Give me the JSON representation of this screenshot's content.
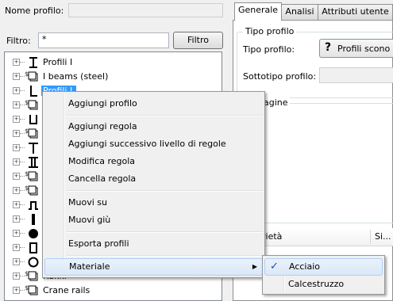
{
  "header": {
    "profile_name_label": "Nome profilo:",
    "profile_name_value": ""
  },
  "filter": {
    "label": "Filtro:",
    "value": "*",
    "button_label": "Filtro"
  },
  "tabs": [
    {
      "label": "Generale",
      "active": true
    },
    {
      "label": "Analisi",
      "active": false
    },
    {
      "label": "Attributi utente",
      "active": false
    }
  ],
  "general": {
    "group_title": "Tipo profilo",
    "type_label": "Tipo profilo:",
    "type_value": "Profili scono",
    "subtype_label": "Sottotipo profilo:",
    "subtype_value": "",
    "image_group_partial": "agine",
    "table_headers": [
      "rietà",
      "Si..."
    ]
  },
  "tree": {
    "items": [
      {
        "label": "Profili I",
        "icon": "i-beam-icon"
      },
      {
        "label": "I beams (steel)",
        "icon": "library-icon"
      },
      {
        "label": "Profili L",
        "icon": "l-profile-icon"
      },
      {
        "label": "",
        "icon": "library-icon"
      },
      {
        "label": "",
        "icon": "u-profile-icon"
      },
      {
        "label": "",
        "icon": "library-icon"
      },
      {
        "label": "",
        "icon": "t-profile-icon"
      },
      {
        "label": "",
        "icon": "double-i-icon"
      },
      {
        "label": "",
        "icon": "library-icon"
      },
      {
        "label": "",
        "icon": "library-icon"
      },
      {
        "label": "",
        "icon": "z-profile-icon"
      },
      {
        "label": "",
        "icon": "flat-bar-icon"
      },
      {
        "label": "",
        "icon": "round-bar-icon"
      },
      {
        "label": "",
        "icon": "rect-hollow-icon"
      },
      {
        "label": "",
        "icon": "circ-hollow-icon"
      },
      {
        "label": "Rukki",
        "icon": "library-icon"
      },
      {
        "label": "Crane rails",
        "icon": "library-icon"
      }
    ]
  },
  "context_menu": {
    "items": [
      {
        "label": "Aggiungi profilo"
      },
      {
        "label": "Aggiungi regola"
      },
      {
        "label": "Aggiungi successivo livello di regole"
      },
      {
        "label": "Modifica regola"
      },
      {
        "label": "Cancella regola"
      },
      {
        "label": "Muovi su"
      },
      {
        "label": "Muovi giù"
      },
      {
        "label": "Esporta profili"
      },
      {
        "label": "Materiale"
      }
    ]
  },
  "submenu": {
    "items": [
      {
        "label": "Acciaio",
        "checked": true
      },
      {
        "label": "Calcestruzzo",
        "checked": false
      }
    ]
  },
  "colors": {
    "highlight": "#3399ff",
    "menu_hover": "#dbe8f8",
    "check": "#1a4fb5"
  }
}
